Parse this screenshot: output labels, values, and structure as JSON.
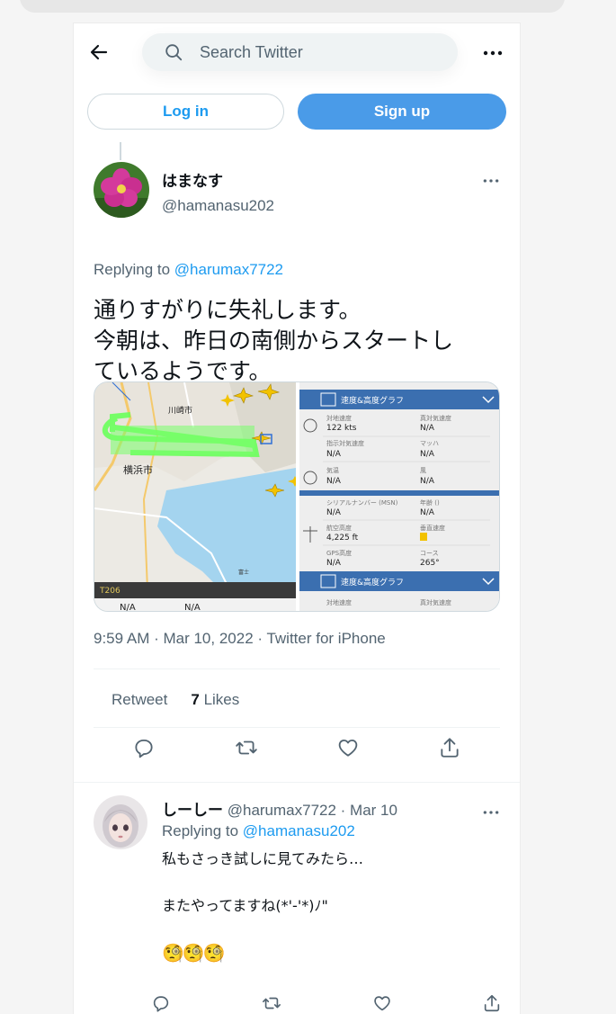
{
  "search": {
    "placeholder": "Search Twitter"
  },
  "auth": {
    "login_label": "Log in",
    "signup_label": "Sign up"
  },
  "tweet": {
    "name": "はまなす",
    "handle": "@hamanasu202",
    "replying_prefix": "Replying to",
    "replying_to": "@harumax7722",
    "text": "通りすがりに失礼します。\n今朝は、昨日の南側からスタートし\nているようです。",
    "timestamp": "9:59 AM · Mar 10, 2022 · Twitter for iPhone",
    "retweet_label": "Retweet",
    "likes_count": "7",
    "likes_label": "Likes"
  },
  "media": {
    "map_labels": {
      "kawasaki": "川崎市",
      "yokohama": "横浜市",
      "fuji": "富士",
      "route": "T206",
      "na1": "N/A",
      "na2": "N/A"
    },
    "panel": {
      "section_title": "速度&高度グラフ",
      "rows": [
        {
          "l1": "対地速度",
          "v1": "122 kts",
          "l2": "真対気速度",
          "v2": "N/A"
        },
        {
          "l1": "指示対気速度",
          "v1": "N/A",
          "l2": "マッハ",
          "v2": "N/A"
        },
        {
          "l1": "気温",
          "v1": "N/A",
          "l2": "風",
          "v2": "N/A"
        },
        {
          "l1": "シリアルナンバー (MSN)",
          "v1": "N/A",
          "l2": "年齢 ()",
          "v2": "N/A"
        },
        {
          "l1": "航空高度",
          "v1": "4,225 ft",
          "l2": "垂直速度",
          "v2": ""
        },
        {
          "l1": "GPS高度",
          "v1": "N/A",
          "l2": "コース",
          "v2": "265°"
        }
      ],
      "section_title2": "速度&高度グラフ",
      "bottom_l1": "対地速度",
      "bottom_l2": "真対気速度"
    }
  },
  "reply": {
    "name": "しーしー",
    "meta": "@harumax7722 · Mar 10",
    "replying_prefix": "Replying to",
    "replying_to": "@hamanasu202",
    "text": "私もさっき試しに見てみたら…\n\nまたやってますね(*'-'*)ﾉ\"",
    "emoji": "🧐🧐🧐"
  },
  "icons": {
    "back": "arrow-left-icon",
    "search": "search-icon",
    "more": "more-icon",
    "reply": "reply-icon",
    "retweet": "retweet-icon",
    "like": "heart-icon",
    "share": "share-icon"
  },
  "colors": {
    "accent": "#1d9bf0",
    "signup": "#4a9be8",
    "text": "#0f1419",
    "muted": "#536471"
  }
}
